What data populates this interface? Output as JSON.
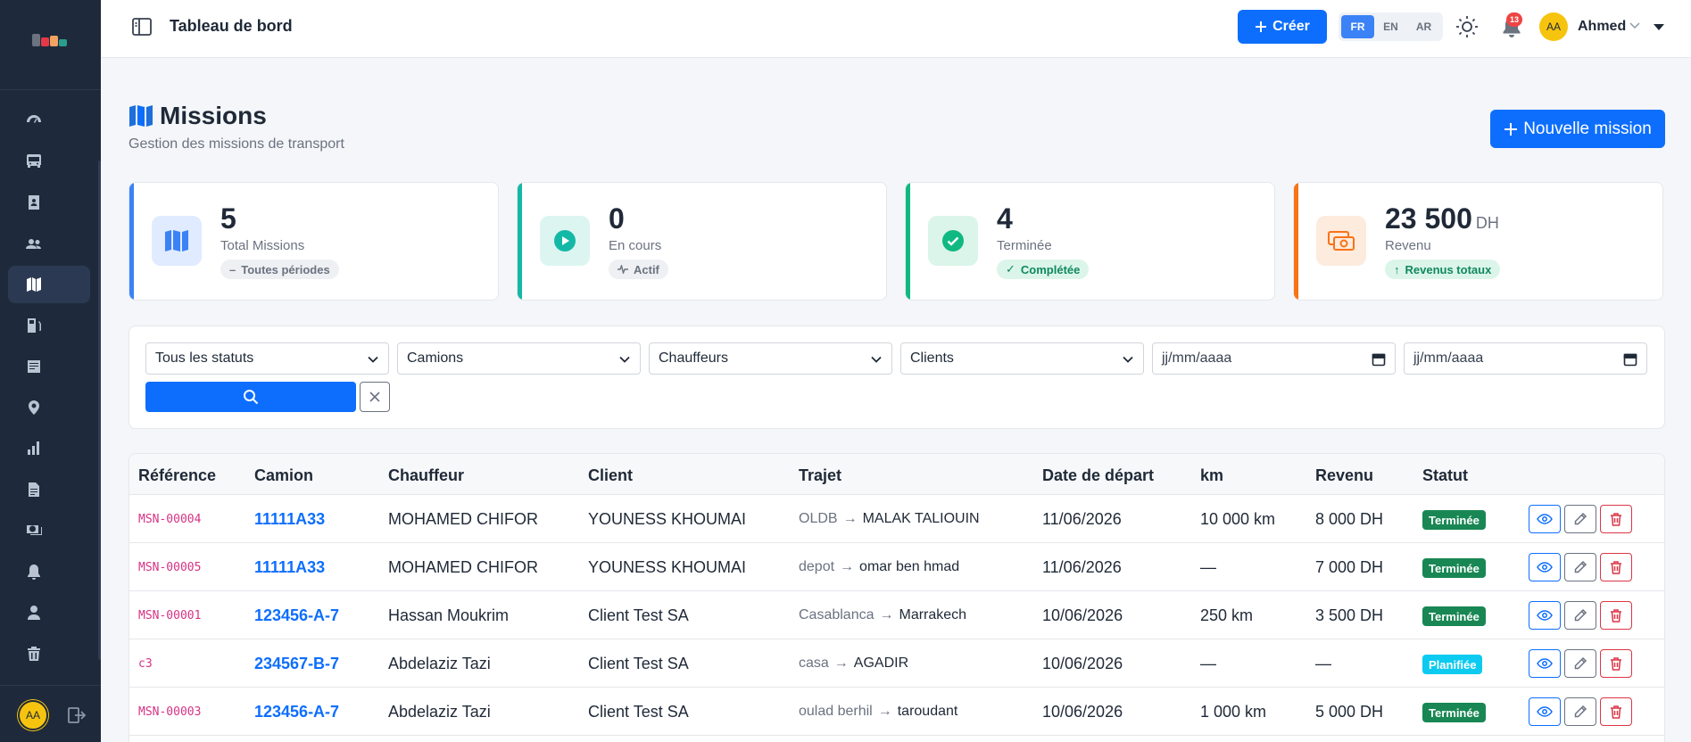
{
  "header": {
    "title": "Tableau de bord",
    "create_label": "Créer",
    "languages": [
      "FR",
      "EN",
      "AR"
    ],
    "active_language": "FR",
    "notification_count": "13",
    "user_initials": "AA",
    "user_name": "Ahmed"
  },
  "sidebar": {
    "user_initials": "AA",
    "items": [
      {
        "icon": "dashboard-icon",
        "active": false
      },
      {
        "icon": "bus-icon",
        "active": false
      },
      {
        "icon": "id-card-icon",
        "active": false
      },
      {
        "icon": "users-icon",
        "active": false
      },
      {
        "icon": "map-icon",
        "active": true
      },
      {
        "icon": "fuel-icon",
        "active": false
      },
      {
        "icon": "receipt-icon",
        "active": false
      },
      {
        "icon": "location-pin-icon",
        "active": false
      },
      {
        "icon": "bar-chart-icon",
        "active": false
      },
      {
        "icon": "document-icon",
        "active": false
      },
      {
        "icon": "cash-icon",
        "active": false
      },
      {
        "icon": "bell-icon",
        "active": false
      },
      {
        "icon": "person-icon",
        "active": false
      },
      {
        "icon": "trash-icon",
        "active": false
      }
    ]
  },
  "page": {
    "title": "Missions",
    "subtitle": "Gestion des missions de transport",
    "new_button": "Nouvelle mission"
  },
  "stats": [
    {
      "value": "5",
      "unit": "",
      "label": "Total Missions",
      "pill": "Toutes périodes",
      "color": "#3b82f6"
    },
    {
      "value": "0",
      "unit": "",
      "label": "En cours",
      "pill": "Actif",
      "color": "#14b8a6"
    },
    {
      "value": "4",
      "unit": "",
      "label": "Terminée",
      "pill": "Complétée",
      "color": "#10b981"
    },
    {
      "value": "23 500",
      "unit": "DH",
      "label": "Revenu",
      "pill": "Revenus totaux",
      "color": "#f97316"
    }
  ],
  "filters": {
    "status": "Tous les statuts",
    "trucks": "Camions",
    "drivers": "Chauffeurs",
    "clients": "Clients",
    "date_from": "jj/mm/aaaa",
    "date_to": "jj/mm/aaaa"
  },
  "table": {
    "columns": [
      "Référence",
      "Camion",
      "Chauffeur",
      "Client",
      "Trajet",
      "Date de départ",
      "km",
      "Revenu",
      "Statut"
    ],
    "rows": [
      {
        "ref": "MSN-00004",
        "truck": "11111A33",
        "driver": "MOHAMED CHIFOR",
        "client": "YOUNESS KHOUMAI",
        "from": "OLDB",
        "to": "MALAK TALIOUIN",
        "date": "11/06/2026",
        "km": "10 000 km",
        "revenue": "8 000 DH",
        "status": "Terminée",
        "status_color": "#198754"
      },
      {
        "ref": "MSN-00005",
        "truck": "11111A33",
        "driver": "MOHAMED CHIFOR",
        "client": "YOUNESS KHOUMAI",
        "from": "depot",
        "to": "omar ben hmad",
        "date": "11/06/2026",
        "km": "—",
        "revenue": "7 000 DH",
        "status": "Terminée",
        "status_color": "#198754"
      },
      {
        "ref": "MSN-00001",
        "truck": "123456-A-7",
        "driver": "Hassan Moukrim",
        "client": "Client Test SA",
        "from": "Casablanca",
        "to": "Marrakech",
        "date": "10/06/2026",
        "km": "250 km",
        "revenue": "3 500 DH",
        "status": "Terminée",
        "status_color": "#198754"
      },
      {
        "ref": "c3",
        "truck": "234567-B-7",
        "driver": "Abdelaziz Tazi",
        "client": "Client Test SA",
        "from": "casa",
        "to": "AGADIR",
        "date": "10/06/2026",
        "km": "—",
        "revenue": "—",
        "status": "Planifiée",
        "status_color": "#0dcaf0"
      },
      {
        "ref": "MSN-00003",
        "truck": "123456-A-7",
        "driver": "Abdelaziz Tazi",
        "client": "Client Test SA",
        "from": "oulad berhil",
        "to": "taroudant",
        "date": "10/06/2026",
        "km": "1 000 km",
        "revenue": "5 000 DH",
        "status": "Terminée",
        "status_color": "#198754"
      }
    ]
  }
}
